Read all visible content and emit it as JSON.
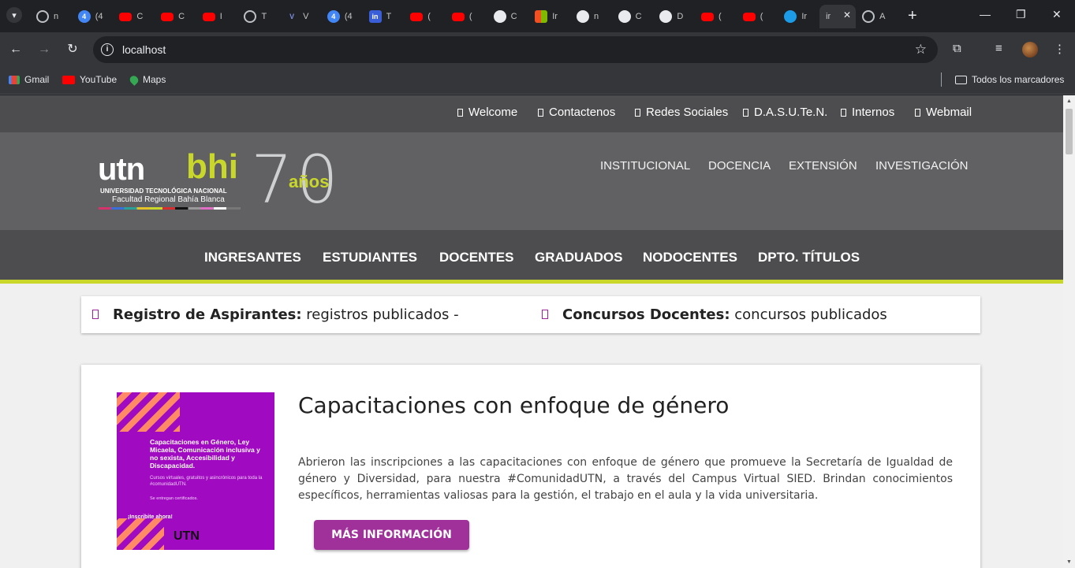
{
  "browser": {
    "tabs": [
      {
        "icon": "globe-icon",
        "label": "n"
      },
      {
        "icon": "g4-icon",
        "label": "(4"
      },
      {
        "icon": "youtube-icon",
        "label": "C"
      },
      {
        "icon": "youtube-icon",
        "label": "C"
      },
      {
        "icon": "youtube-icon",
        "label": "I"
      },
      {
        "icon": "globe-icon",
        "label": "T"
      },
      {
        "icon": "v-icon",
        "label": "V"
      },
      {
        "icon": "g4-icon",
        "label": "(4"
      },
      {
        "icon": "in-icon",
        "label": "T"
      },
      {
        "icon": "youtube-icon",
        "label": "("
      },
      {
        "icon": "youtube-icon",
        "label": "("
      },
      {
        "icon": "github-icon",
        "label": "C"
      },
      {
        "icon": "microsoft-icon",
        "label": "Ir"
      },
      {
        "icon": "github-icon",
        "label": "n"
      },
      {
        "icon": "github-icon",
        "label": "C"
      },
      {
        "icon": "github-icon",
        "label": "D"
      },
      {
        "icon": "youtube-icon",
        "label": "("
      },
      {
        "icon": "youtube-icon",
        "label": "("
      },
      {
        "icon": "edge-icon",
        "label": "Ir"
      }
    ],
    "active_tab": {
      "label": "ir",
      "close": "✕"
    },
    "after_tab": {
      "label": "A"
    },
    "url": "localhost",
    "bookmarks": [
      {
        "label": "Gmail",
        "icon": "gmail-icon"
      },
      {
        "label": "YouTube",
        "icon": "youtube-icon"
      },
      {
        "label": "Maps",
        "icon": "maps-icon"
      }
    ],
    "all_bookmarks": "Todos los marcadores"
  },
  "site": {
    "topnav": [
      "Welcome",
      "Contactenos",
      "Redes Sociales",
      "D.A.S.U.Te.N.",
      "Internos",
      "Webmail"
    ],
    "logo": {
      "utn": "utn",
      "bhi": "bhi",
      "line1": "UNIVERSIDAD TECNOLÓGICA NACIONAL",
      "line2": "Facultad Regional Bahía Blanca",
      "seventy": "70",
      "anios": "años"
    },
    "mainmenu": [
      "INSTITUCIONAL",
      "DOCENCIA",
      "EXTENSIÓN",
      "INVESTIGACIÓN"
    ],
    "secmenu": [
      "INGRESANTES",
      "ESTUDIANTES",
      "DOCENTES",
      "GRADUADOS",
      "NODOCENTES",
      "DPTO. TÍTULOS"
    ],
    "ticker": [
      {
        "title": "Registro de Aspirantes:",
        "text": " registros publicados -"
      },
      {
        "title": "Concursos Docentes:",
        "text": " concursos publicados"
      }
    ],
    "news": {
      "title": "Capacitaciones con enfoque de género",
      "description": "Abrieron las inscripciones a las capacitaciones con enfoque de género que promueve la Secretaría de Igualdad de género y Diversidad, para nuestra #ComunidadUTN, a través del Campus Virtual SIED. Brindan conocimientos específicos, herramientas valiosas para la gestión, el trabajo en el aula y la vida universitaria.",
      "button": "MÁS INFORMACIÓN",
      "flyer": {
        "headline": "Capacitaciones en Género, Ley Micaela, Comunicación inclusiva y no sexista, Accesibilidad y Discapacidad.",
        "sub": "Cursos virtuales, gratuitos y asincrónicos para toda la #comunidadUTN.",
        "cert": "Se entregan certificados.",
        "cta": "¡Inscribite ahora!",
        "brand": "UTN"
      }
    }
  },
  "colors": {
    "accent": "#c9d72b",
    "purple": "#a0309a",
    "header_dark": "#4d4d4f",
    "header_mid": "#616163"
  }
}
